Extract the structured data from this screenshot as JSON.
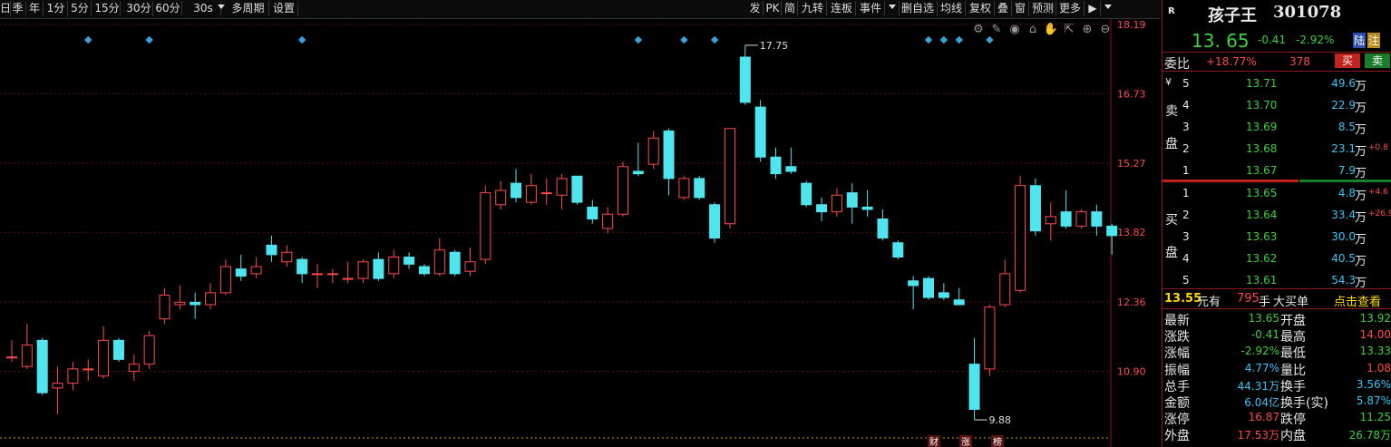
{
  "toolbar": {
    "left": [
      "日",
      "季",
      "年",
      "1分",
      "5分",
      "15分",
      "30分",
      "60分",
      "30s",
      "多周期",
      "设置"
    ],
    "right": [
      "发",
      "PK",
      "简",
      "九转",
      "连板",
      "事件",
      "",
      "删自选",
      "均线",
      "复权",
      "叠",
      "窗",
      "预测",
      "更多"
    ]
  },
  "chart": {
    "y_ticks": [
      "18.19",
      "16.73",
      "15.27",
      "13.82",
      "12.36",
      "10.90"
    ],
    "high_label": "17.75",
    "low_label": "9.88",
    "bottom_marks": [
      "财",
      "涨",
      "榜"
    ]
  },
  "chart_data": {
    "type": "candlestick",
    "ylim": [
      9.5,
      18.3
    ],
    "candles": [
      {
        "o": 11.2,
        "c": 11.2,
        "h": 11.55,
        "l": 11.1
      },
      {
        "o": 11.0,
        "c": 11.45,
        "h": 11.9,
        "l": 10.95
      },
      {
        "o": 11.55,
        "c": 10.45,
        "h": 11.6,
        "l": 10.4
      },
      {
        "o": 10.55,
        "c": 10.65,
        "h": 11.0,
        "l": 10.0
      },
      {
        "o": 10.65,
        "c": 10.95,
        "h": 11.1,
        "l": 10.5
      },
      {
        "o": 10.95,
        "c": 10.95,
        "h": 11.15,
        "l": 10.7
      },
      {
        "o": 10.8,
        "c": 11.55,
        "h": 11.85,
        "l": 10.75
      },
      {
        "o": 11.55,
        "c": 11.15,
        "h": 11.6,
        "l": 11.1
      },
      {
        "o": 10.9,
        "c": 11.05,
        "h": 11.25,
        "l": 10.7
      },
      {
        "o": 11.05,
        "c": 11.65,
        "h": 11.75,
        "l": 10.95
      },
      {
        "o": 12.0,
        "c": 12.5,
        "h": 12.65,
        "l": 11.9
      },
      {
        "o": 12.3,
        "c": 12.35,
        "h": 12.7,
        "l": 12.2
      },
      {
        "o": 12.35,
        "c": 12.3,
        "h": 12.55,
        "l": 12.0
      },
      {
        "o": 12.3,
        "c": 12.55,
        "h": 12.75,
        "l": 12.2
      },
      {
        "o": 12.55,
        "c": 13.1,
        "h": 13.25,
        "l": 12.5
      },
      {
        "o": 13.05,
        "c": 12.9,
        "h": 13.35,
        "l": 12.8
      },
      {
        "o": 12.95,
        "c": 13.1,
        "h": 13.3,
        "l": 12.85
      },
      {
        "o": 13.55,
        "c": 13.35,
        "h": 13.75,
        "l": 13.2
      },
      {
        "o": 13.2,
        "c": 13.4,
        "h": 13.55,
        "l": 13.1
      },
      {
        "o": 13.25,
        "c": 12.95,
        "h": 13.3,
        "l": 12.75
      },
      {
        "o": 12.95,
        "c": 12.95,
        "h": 13.15,
        "l": 12.65
      },
      {
        "o": 12.95,
        "c": 12.95,
        "h": 13.05,
        "l": 12.75
      },
      {
        "o": 12.85,
        "c": 12.85,
        "h": 13.2,
        "l": 12.75
      },
      {
        "o": 12.85,
        "c": 13.2,
        "h": 13.25,
        "l": 12.75
      },
      {
        "o": 13.25,
        "c": 12.85,
        "h": 13.4,
        "l": 12.8
      },
      {
        "o": 12.95,
        "c": 13.3,
        "h": 13.45,
        "l": 12.85
      },
      {
        "o": 13.3,
        "c": 13.15,
        "h": 13.4,
        "l": 13.05
      },
      {
        "o": 13.1,
        "c": 12.95,
        "h": 13.15,
        "l": 12.9
      },
      {
        "o": 12.95,
        "c": 13.45,
        "h": 13.7,
        "l": 12.9
      },
      {
        "o": 13.4,
        "c": 12.95,
        "h": 13.45,
        "l": 12.9
      },
      {
        "o": 13.0,
        "c": 13.2,
        "h": 13.5,
        "l": 12.9
      },
      {
        "o": 13.25,
        "c": 14.65,
        "h": 14.8,
        "l": 13.15
      },
      {
        "o": 14.4,
        "c": 14.7,
        "h": 14.9,
        "l": 14.3
      },
      {
        "o": 14.85,
        "c": 14.55,
        "h": 15.15,
        "l": 14.45
      },
      {
        "o": 14.45,
        "c": 14.8,
        "h": 15.05,
        "l": 14.4
      },
      {
        "o": 14.65,
        "c": 14.65,
        "h": 14.95,
        "l": 14.4
      },
      {
        "o": 14.6,
        "c": 14.95,
        "h": 15.05,
        "l": 14.3
      },
      {
        "o": 15.0,
        "c": 14.45,
        "h": 15.0,
        "l": 14.4
      },
      {
        "o": 14.35,
        "c": 14.1,
        "h": 14.5,
        "l": 14.0
      },
      {
        "o": 13.9,
        "c": 14.2,
        "h": 14.35,
        "l": 13.8
      },
      {
        "o": 14.2,
        "c": 15.2,
        "h": 15.3,
        "l": 14.15
      },
      {
        "o": 15.1,
        "c": 15.05,
        "h": 15.7,
        "l": 15.0
      },
      {
        "o": 15.25,
        "c": 15.8,
        "h": 15.95,
        "l": 15.15
      },
      {
        "o": 15.95,
        "c": 14.95,
        "h": 16.0,
        "l": 14.6
      },
      {
        "o": 14.55,
        "c": 14.95,
        "h": 15.0,
        "l": 14.5
      },
      {
        "o": 14.95,
        "c": 14.55,
        "h": 15.0,
        "l": 14.5
      },
      {
        "o": 14.4,
        "c": 13.7,
        "h": 14.45,
        "l": 13.6
      },
      {
        "o": 14.0,
        "c": 16.0,
        "h": 16.0,
        "l": 13.9
      },
      {
        "o": 17.5,
        "c": 16.55,
        "h": 17.75,
        "l": 16.5
      },
      {
        "o": 16.45,
        "c": 15.4,
        "h": 16.6,
        "l": 15.3
      },
      {
        "o": 15.4,
        "c": 15.05,
        "h": 15.6,
        "l": 14.95
      },
      {
        "o": 15.2,
        "c": 15.1,
        "h": 15.6,
        "l": 15.05
      },
      {
        "o": 14.85,
        "c": 14.4,
        "h": 14.9,
        "l": 14.35
      },
      {
        "o": 14.4,
        "c": 14.25,
        "h": 14.55,
        "l": 14.05
      },
      {
        "o": 14.25,
        "c": 14.6,
        "h": 14.75,
        "l": 14.15
      },
      {
        "o": 14.65,
        "c": 14.35,
        "h": 14.85,
        "l": 14.0
      },
      {
        "o": 14.35,
        "c": 14.3,
        "h": 14.7,
        "l": 14.15
      },
      {
        "o": 14.1,
        "c": 13.7,
        "h": 14.3,
        "l": 13.65
      },
      {
        "o": 13.6,
        "c": 13.3,
        "h": 13.65,
        "l": 13.25
      },
      {
        "o": 12.8,
        "c": 12.7,
        "h": 12.9,
        "l": 12.2
      },
      {
        "o": 12.85,
        "c": 12.45,
        "h": 12.9,
        "l": 12.4
      },
      {
        "o": 12.55,
        "c": 12.45,
        "h": 12.75,
        "l": 12.4
      },
      {
        "o": 12.4,
        "c": 12.3,
        "h": 12.65,
        "l": 12.3
      },
      {
        "o": 11.05,
        "c": 10.1,
        "h": 11.6,
        "l": 9.88
      },
      {
        "o": 10.95,
        "c": 12.25,
        "h": 12.3,
        "l": 10.8
      },
      {
        "o": 12.3,
        "c": 12.95,
        "h": 13.25,
        "l": 12.25
      },
      {
        "o": 12.6,
        "c": 14.8,
        "h": 15.0,
        "l": 12.55
      },
      {
        "o": 14.8,
        "c": 13.85,
        "h": 14.95,
        "l": 13.75
      },
      {
        "o": 14.0,
        "c": 14.15,
        "h": 14.45,
        "l": 13.65
      },
      {
        "o": 14.25,
        "c": 13.95,
        "h": 14.7,
        "l": 13.9
      },
      {
        "o": 13.95,
        "c": 14.25,
        "h": 14.3,
        "l": 13.9
      },
      {
        "o": 14.25,
        "c": 13.95,
        "h": 14.4,
        "l": 13.75
      },
      {
        "o": 13.95,
        "c": 13.75,
        "h": 14.0,
        "l": 13.35
      }
    ],
    "markers_at": [
      5,
      9,
      19,
      41,
      44,
      46,
      60,
      61,
      62,
      64
    ]
  },
  "quote": {
    "flag": "R",
    "name": "孩子王",
    "code": "301078",
    "price": "13. 65",
    "change": "-0.41",
    "pct": "-2.92%",
    "tag1": "陆",
    "tag2": "注",
    "weibi_label": "委比",
    "weibi_value": "+18.77%",
    "weicha": "378",
    "buy_btn": "买",
    "sell_btn": "卖"
  },
  "sell_orders": [
    {
      "idx": "5",
      "price": "13.71",
      "vol": "49.6",
      "unit": "万",
      "extra": ""
    },
    {
      "idx": "4",
      "price": "13.70",
      "vol": "22.9",
      "unit": "万",
      "extra": ""
    },
    {
      "idx": "3",
      "price": "13.69",
      "vol": "8.5",
      "unit": "万",
      "extra": ""
    },
    {
      "idx": "2",
      "price": "13.68",
      "vol": "23.1",
      "unit": "万",
      "extra": "+0.8"
    },
    {
      "idx": "1",
      "price": "13.67",
      "vol": "7.9",
      "unit": "万",
      "extra": ""
    }
  ],
  "sell_labels": [
    "¥",
    "卖",
    "盘"
  ],
  "buy_orders": [
    {
      "idx": "1",
      "price": "13.65",
      "vol": "4.8",
      "unit": "万",
      "extra": "+4.6"
    },
    {
      "idx": "2",
      "price": "13.64",
      "vol": "33.4",
      "unit": "万",
      "extra": "+26.9"
    },
    {
      "idx": "3",
      "price": "13.63",
      "vol": "30.0",
      "unit": "万",
      "extra": ""
    },
    {
      "idx": "4",
      "price": "13.62",
      "vol": "40.5",
      "unit": "万",
      "extra": ""
    },
    {
      "idx": "5",
      "price": "13.61",
      "vol": "54.3",
      "unit": "万",
      "extra": ""
    }
  ],
  "buy_labels": [
    "买",
    "盘"
  ],
  "bigorder": {
    "price": "13.55",
    "text1": "元有",
    "qty": "795",
    "text2": "手",
    "text3": "大买单",
    "link": "点击查看"
  },
  "stats": [
    {
      "l1": "最新",
      "v1": "13.65",
      "c1": "green",
      "l2": "开盘",
      "v2": "13.92",
      "c2": "green"
    },
    {
      "l1": "涨跌",
      "v1": "-0.41",
      "c1": "green",
      "l2": "最高",
      "v2": "14.00",
      "c2": "red"
    },
    {
      "l1": "涨幅",
      "v1": "-2.92%",
      "c1": "green",
      "l2": "最低",
      "v2": "13.33",
      "c2": "green"
    },
    {
      "l1": "振幅",
      "v1": "4.77%",
      "c1": "cyan",
      "l2": "量比",
      "v2": "1.08",
      "c2": "red"
    },
    {
      "l1": "总手",
      "v1": "44.31万",
      "c1": "cyan",
      "l2": "换手",
      "v2": "3.56%",
      "c2": "cyan"
    },
    {
      "l1": "金额",
      "v1": "6.04亿",
      "c1": "cyan",
      "l2": "换手(实)",
      "v2": "5.87%",
      "c2": "cyan"
    },
    {
      "l1": "涨停",
      "v1": "16.87",
      "c1": "red",
      "l2": "跌停",
      "v2": "11.25",
      "c2": "green"
    },
    {
      "l1": "外盘",
      "v1": "17.53万",
      "c1": "red",
      "l2": "内盘",
      "v2": "26.78万",
      "c2": "green"
    }
  ],
  "colors": {
    "up": "#ff4a4a",
    "down": "#4fe5ef",
    "marker": "#3aa0d8",
    "grid": "#5a1010"
  }
}
